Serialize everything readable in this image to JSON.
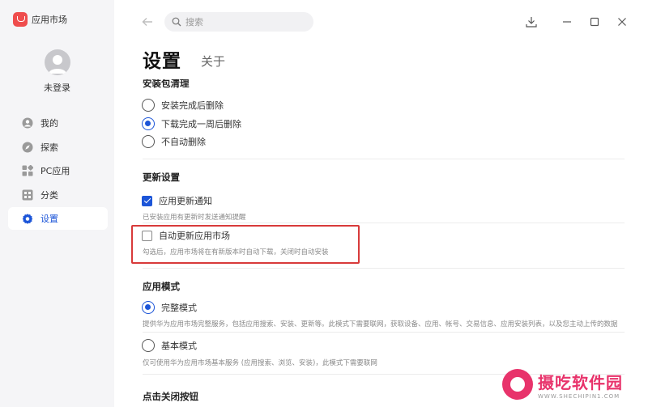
{
  "app": {
    "title": "应用市场",
    "brand_color": "#ef4d4d"
  },
  "user": {
    "login_label": "未登录"
  },
  "sidebar": {
    "items": [
      {
        "label": "我的",
        "icon": "user-icon",
        "active": false
      },
      {
        "label": "探索",
        "icon": "compass-icon",
        "active": false
      },
      {
        "label": "PC应用",
        "icon": "grid-icon",
        "active": false
      },
      {
        "label": "分类",
        "icon": "category-icon",
        "active": false
      },
      {
        "label": "设置",
        "icon": "gear-icon",
        "active": true
      }
    ]
  },
  "search": {
    "placeholder": "搜索",
    "value": ""
  },
  "page": {
    "title": "设置",
    "tab_about": "关于"
  },
  "sections": {
    "cleanup": {
      "title": "安装包清理",
      "options": [
        "安装完成后删除",
        "下载完成一周后删除",
        "不自动删除"
      ],
      "selected": 1
    },
    "update": {
      "title": "更新设置",
      "notify_label": "应用更新通知",
      "notify_checked": true,
      "notify_desc": "已安装应用有更新时发送通知提醒",
      "auto_label": "自动更新应用市场",
      "auto_checked": false,
      "auto_desc": "勾选后，应用市场将在有新版本时自动下载，关闭时自动安装"
    },
    "mode": {
      "title": "应用模式",
      "full_label": "完整模式",
      "full_desc": "提供华为应用市场完整服务，包括应用搜索、安装、更新等。此模式下需要联网，获取设备、应用、帐号、交易信息、应用安装列表，以及您主动上传的数据",
      "basic_label": "基本模式",
      "basic_desc": "仅可使用华为应用市场基本服务 (应用搜索、浏览、安装)，此模式下需要联网",
      "selected": "full"
    },
    "close": {
      "title": "点击关闭按钮"
    }
  },
  "colors": {
    "accent": "#1c55d8",
    "highlight": "#d83a3a"
  },
  "watermark": {
    "name": "摄吃软件园",
    "url": "WWW.SHECHIPIN1.COM"
  }
}
